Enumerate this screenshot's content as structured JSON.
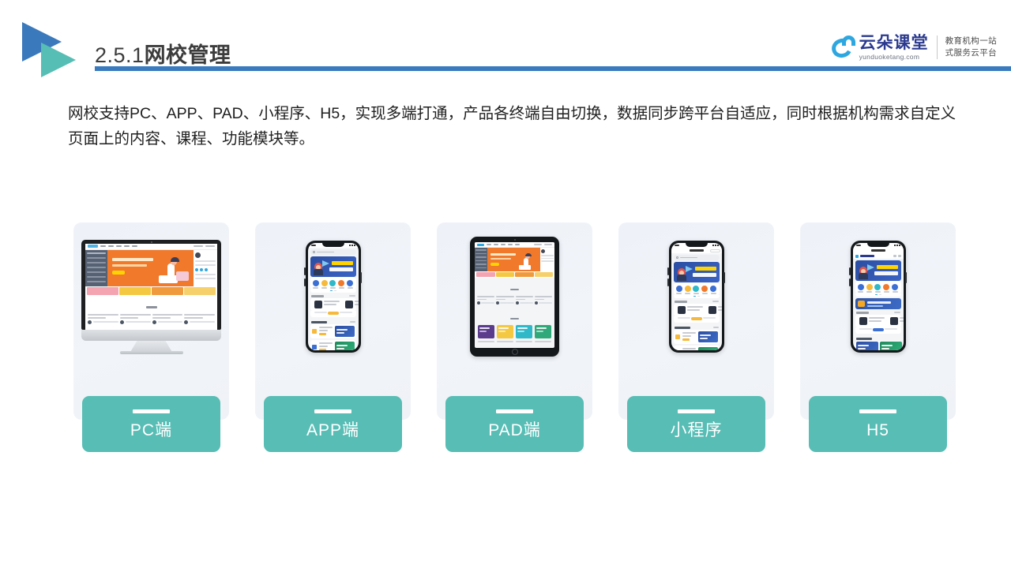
{
  "header": {
    "section_number": "2.5.1",
    "section_title": "网校管理",
    "logo_icon": "double-triangle-play-icon",
    "rule_color": "#3A7BBF"
  },
  "brand": {
    "cloud_icon": "cloud-icon",
    "name": "云朵课堂",
    "url": "yunduoketang.com",
    "tagline_line1": "教育机构一站",
    "tagline_line2": "式服务云平台",
    "name_color": "#2B3A8F",
    "cloud_color": "#2EA7E0"
  },
  "intro": {
    "paragraph": "网校支持PC、APP、PAD、小程序、H5，实现多端打通，产品各终端自由切换，数据同步跨平台自适应，同时根据机构需求自定义页面上的内容、课程、功能模块等。"
  },
  "theme": {
    "teal": "#57BDB5",
    "card_bg": "#EEF2F8",
    "banner_orange": "#F0792B",
    "banner_blue": "#2B4EA2"
  },
  "cards": [
    {
      "label": "PC端",
      "device": "desktop-monitor"
    },
    {
      "label": "APP端",
      "device": "smartphone"
    },
    {
      "label": "PAD端",
      "device": "tablet"
    },
    {
      "label": "小程序",
      "device": "smartphone-miniprogram"
    },
    {
      "label": "H5",
      "device": "smartphone-browser"
    }
  ]
}
